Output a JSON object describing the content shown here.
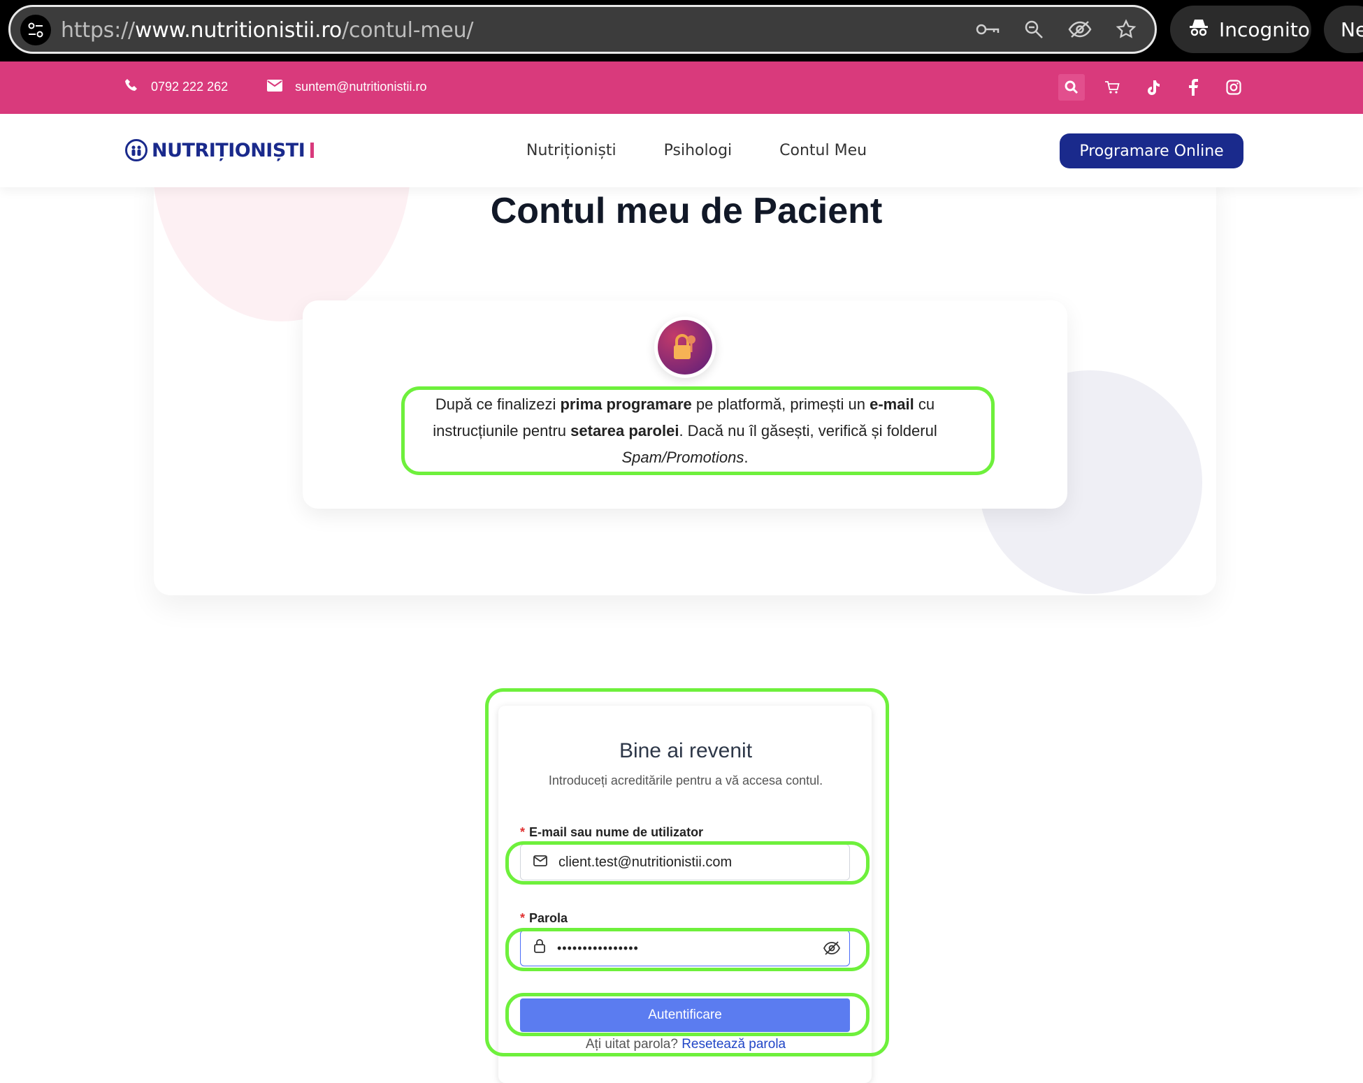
{
  "browser": {
    "url_scheme": "https://",
    "url_host": "www.nutritionistii.ro",
    "url_path": "/contul-meu/",
    "incognito_label": "Incognito",
    "next_chip": "Ne"
  },
  "topbar": {
    "phone": "0792 222 262",
    "email": "suntem@nutritionistii.ro",
    "bg_color": "#d93a7c"
  },
  "nav": {
    "logo_text": "NUTRIȚIONIȘTI",
    "items": [
      "Nutriționiști",
      "Psihologi",
      "Contul Meu"
    ],
    "cta_label": "Programare Online"
  },
  "page": {
    "title": "Contul meu de Pacient",
    "info": {
      "t1": "După ce finalizezi ",
      "b1": "prima programare",
      "t2": " pe platformă, primești un ",
      "b2": "e-mail",
      "t3": " cu instrucțiunile pentru ",
      "b3": "setarea parolei",
      "t4": ". Dacă nu îl găsești, verifică și folderul ",
      "i1": "Spam/Promotions",
      "t5": "."
    }
  },
  "login": {
    "title": "Bine ai revenit",
    "subtitle": "Introduceți acreditările pentru a vă accesa contul.",
    "email_label": "E-mail sau nume de utilizator",
    "email_value": "client.test@nutritionistii.com",
    "password_label": "Parola",
    "password_value": "••••••••••••••••",
    "required_mark": "*",
    "submit_label": "Autentificare",
    "forgot_text": "Ați uitat parola?",
    "forgot_link": "Resetează parola"
  },
  "colors": {
    "brand_pink": "#d93a7c",
    "brand_navy": "#1a2a8c",
    "submit_blue": "#5b7cf0",
    "highlight": "#6ef03c"
  }
}
